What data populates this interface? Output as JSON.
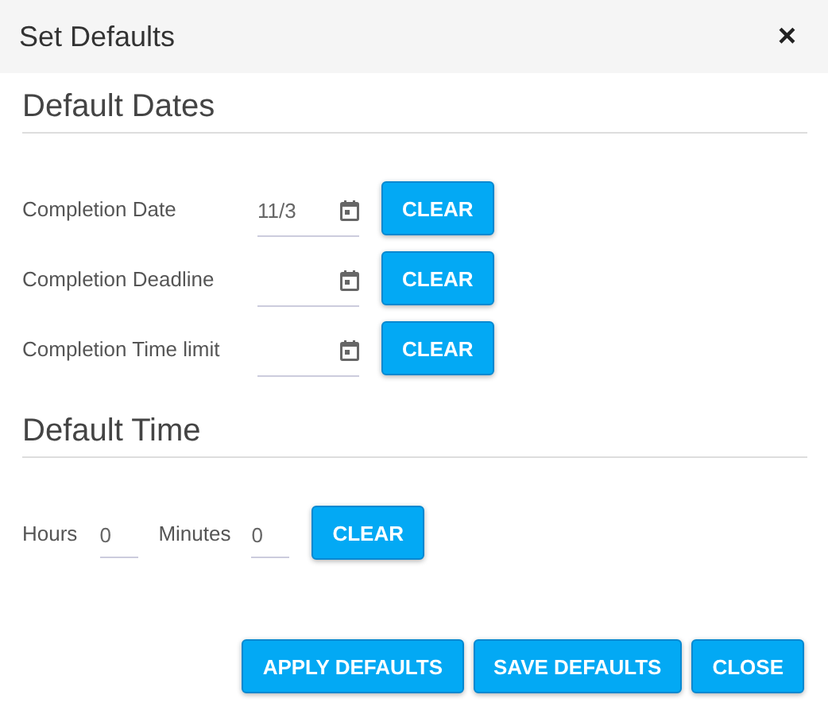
{
  "window": {
    "title": "Set Defaults",
    "close": "×"
  },
  "date_section": {
    "title": "Default Dates",
    "rows": [
      {
        "label": "Completion Date",
        "value": "11/3",
        "button": "CLEAR"
      },
      {
        "label": "Completion Deadline",
        "value": "",
        "button": "CLEAR"
      },
      {
        "label": "Completion Time limit",
        "value": "",
        "button": "CLEAR"
      }
    ]
  },
  "time_section": {
    "title": "Default Time",
    "hours_label": "Hours",
    "hours": "0",
    "minutes_label": "Minutes",
    "minutes": "0",
    "button": "CLEAR"
  },
  "footer_buttons": [
    "APPLY DEFAULTS",
    "SAVE DEFAULTS",
    "CLOSE"
  ]
}
